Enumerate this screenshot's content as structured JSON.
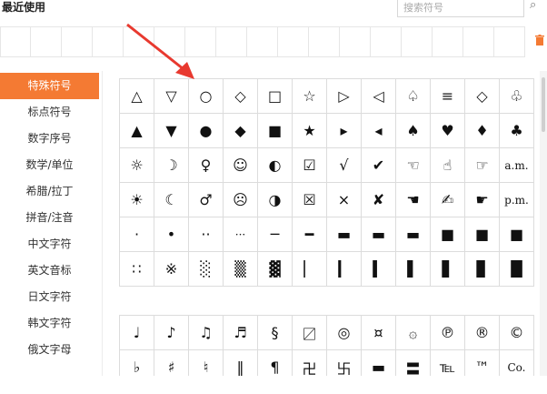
{
  "recent": {
    "title": "最近使用",
    "cells": 17
  },
  "search": {
    "placeholder": "搜索符号",
    "icon": "search-icon"
  },
  "accent": "#f47a33",
  "categories": [
    "特殊符号",
    "标点符号",
    "数字序号",
    "数学/单位",
    "希腊/拉丁",
    "拼音/注音",
    "中文字符",
    "英文音标",
    "日文字符",
    "韩文字符",
    "俄文字母"
  ],
  "active_category": 0,
  "grid1": [
    [
      "△",
      "▽",
      "○",
      "◇",
      "□",
      "☆",
      "▷",
      "◁",
      "♤",
      "≡",
      "◇",
      "♧"
    ],
    [
      "▲",
      "▼",
      "●",
      "◆",
      "■",
      "★",
      "▸",
      "◂",
      "♠",
      "♥",
      "♦",
      "♣"
    ],
    [
      "☼",
      "☽",
      "♀",
      "☺",
      "◐",
      "☑",
      "√",
      "✔",
      "☜",
      "☝",
      "☞",
      "a.m."
    ],
    [
      "☀",
      "☾",
      "♂",
      "☹",
      "◑",
      "☒",
      "×",
      "✘",
      "☚",
      "✍",
      "☛",
      "p.m."
    ],
    [
      "·",
      "•",
      "··",
      "···",
      "─",
      "━",
      "▬",
      "▬",
      "▬",
      "■",
      "■",
      "■"
    ],
    [
      "∷",
      "※",
      "░",
      "▒",
      "▓",
      "▏",
      "▎",
      "▍",
      "▌",
      "▋",
      "▊",
      "█"
    ]
  ],
  "grid2": [
    [
      "♩",
      "♪",
      "♫",
      "♬",
      "§",
      "〼",
      "◎",
      "¤",
      "۞",
      "℗",
      "®",
      "©"
    ],
    [
      "♭",
      "♯",
      "♮",
      "‖",
      "¶",
      "卍",
      "卐",
      "▬",
      "〓",
      "℡",
      "™",
      "Co."
    ]
  ]
}
